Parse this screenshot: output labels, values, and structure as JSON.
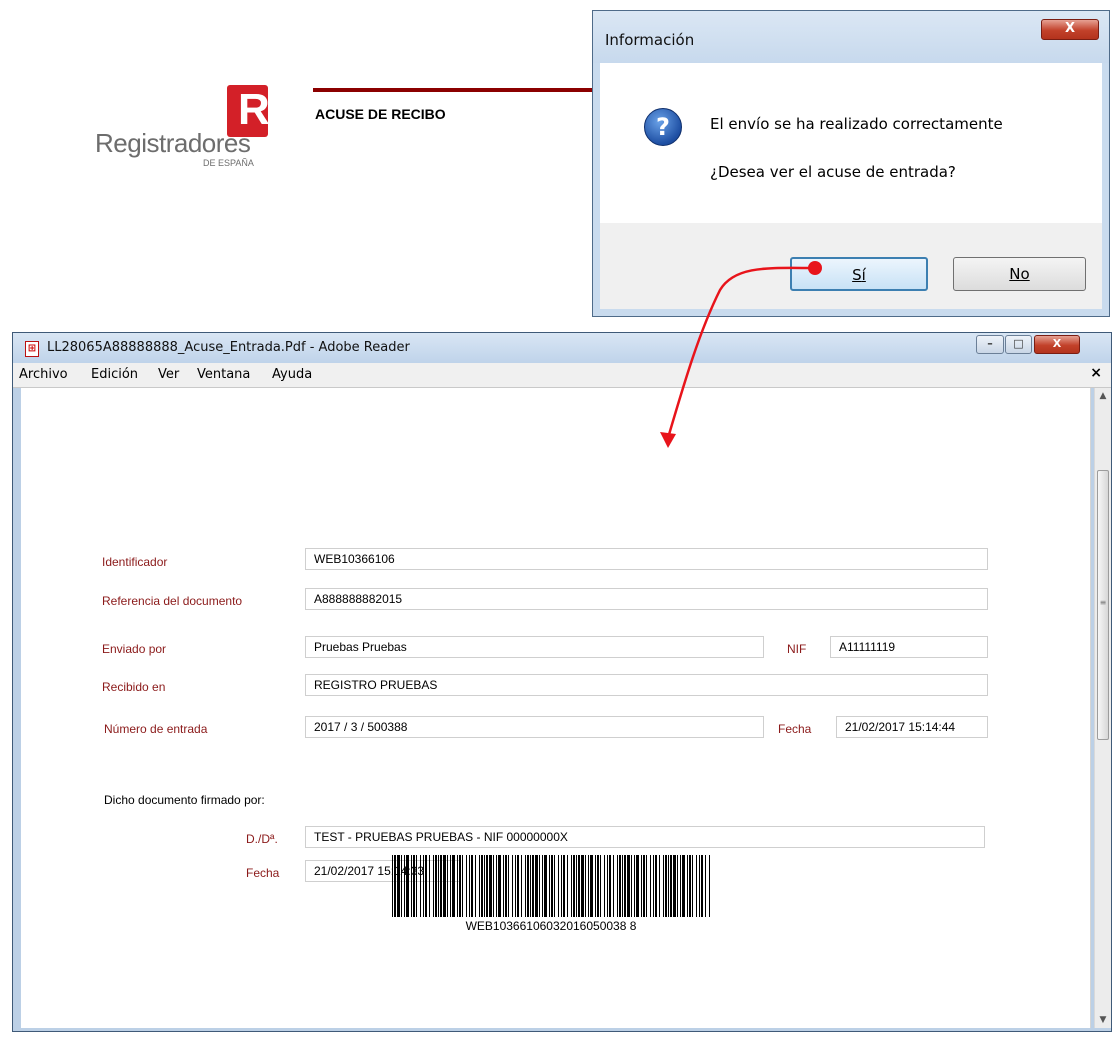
{
  "reader": {
    "title": "LL28065A88888888_Acuse_Entrada.Pdf - Adobe Reader",
    "menu": [
      "Archivo",
      "Edición",
      "Ver",
      "Ventana",
      "Ayuda"
    ],
    "menu_close": "×",
    "window_buttons": {
      "minimize": "–",
      "maximize": "□",
      "close": "X"
    }
  },
  "document": {
    "logo": {
      "mark": "R",
      "name": "Registradores",
      "subtitle": "DE ESPAÑA"
    },
    "heading": "ACUSE DE RECIBO",
    "fields": {
      "identificador_label": "Identificador",
      "identificador_value": "WEB10366106",
      "referencia_label": "Referencia del documento",
      "referencia_value": "A888888882015",
      "enviado_label": "Enviado por",
      "enviado_value": "Pruebas Pruebas",
      "nif_label": "NIF",
      "nif_value": "A11111119",
      "recibido_label": "Recibido en",
      "recibido_value": "REGISTRO PRUEBAS",
      "numero_label": "Número de entrada",
      "numero_value": "2017 / 3 / 500388",
      "fecha_label": "Fecha",
      "fecha_value": "21/02/2017 15:14:44"
    },
    "firmado": {
      "title": "Dicho documento firmado por:",
      "dd_label": "D./Dª.",
      "dd_value": "TEST - PRUEBAS PRUEBAS - NIF 00000000X",
      "fecha_label": "Fecha",
      "fecha_value": "21/02/2017 15:14:33"
    },
    "barcode_text": "WEB10366106032016050038 8"
  },
  "dialog": {
    "title": "Información",
    "close": "X",
    "message": "El envío se ha realizado correctamente",
    "question": "¿Desea ver el acuse de entrada?",
    "yes": {
      "mnemonic": "S",
      "rest": "í"
    },
    "no": {
      "mnemonic": "N",
      "rest": "o"
    }
  },
  "colors": {
    "label_red": "#8b1a1a",
    "rule_dark_red": "#8b0000",
    "logo_red": "#d32028",
    "annotation_arrow": "#e8141b"
  },
  "icons": [
    "pdf-icon",
    "question-icon",
    "minimize-icon",
    "maximize-icon",
    "close-icon"
  ]
}
